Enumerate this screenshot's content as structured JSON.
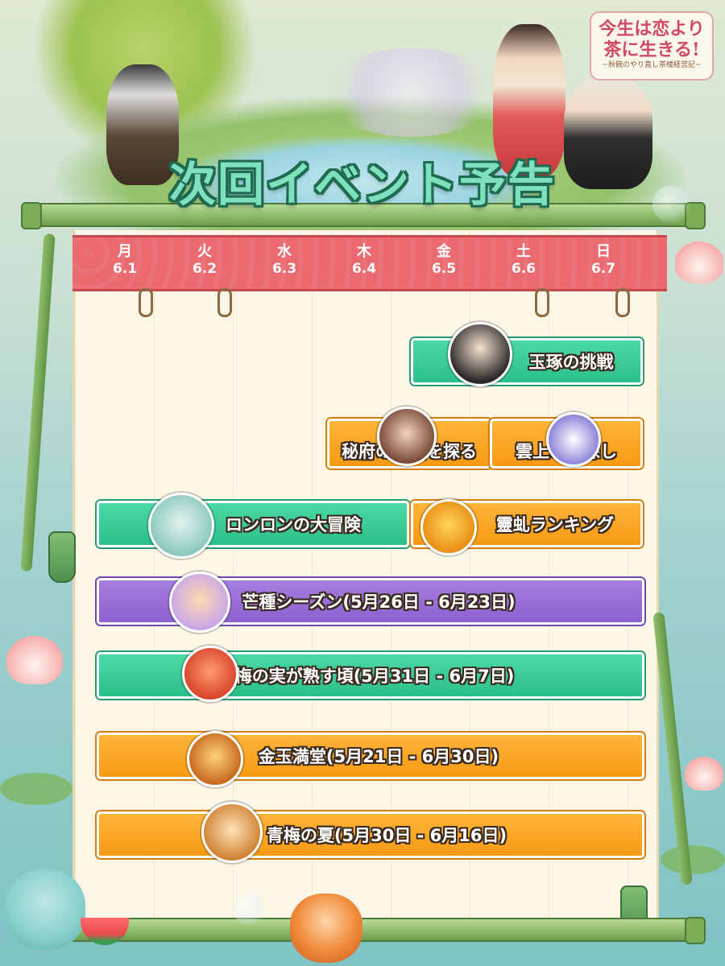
{
  "title": "次回イベント予告",
  "logo": {
    "line1": "今生は恋より",
    "line2": "茶に生きる!",
    "subtitle": "~秋碗のやり直し茶楼経営記~"
  },
  "colors": {
    "day_band": "#ea6a70",
    "teal": "#2cbf8a",
    "orange": "#f79a14",
    "purple": "#8b62cf",
    "paper": "#fbf6e6"
  },
  "days": [
    {
      "weekday": "月",
      "date": "6.1"
    },
    {
      "weekday": "火",
      "date": "6.2"
    },
    {
      "weekday": "水",
      "date": "6.3"
    },
    {
      "weekday": "木",
      "date": "6.4"
    },
    {
      "weekday": "金",
      "date": "6.5"
    },
    {
      "weekday": "土",
      "date": "6.6"
    },
    {
      "weekday": "日",
      "date": "6.7"
    }
  ],
  "events": [
    {
      "label": "玉琢の挑戦",
      "color": "teal",
      "icon": "girl-portrait-icon"
    },
    {
      "label": "秘府の奥義を探る",
      "color": "orange",
      "icon": "lady-room-icon"
    },
    {
      "label": "雲上の宝探し",
      "color": "orange",
      "icon": "cloud-bird-icon"
    },
    {
      "label": "ロンロンの大冒険",
      "color": "teal",
      "icon": "dragon-cat-icon"
    },
    {
      "label": "靈虬ランキング",
      "color": "orange",
      "icon": "golden-dragon-icon"
    },
    {
      "label": "芒種シーズン(5月26日 - 6月23日)",
      "color": "purple",
      "icon": "farmer-cat-icon"
    },
    {
      "label": "梅の実が熟す頃(5月31日 - 6月7日)",
      "color": "teal",
      "icon": "red-fox-icon"
    },
    {
      "label": "金玉満堂(5月21日 - 6月30日)",
      "color": "orange",
      "icon": "treasure-pot-icon"
    },
    {
      "label": "青梅の夏(5月30日 - 6月16日)",
      "color": "orange",
      "icon": "shiba-warrior-icon"
    }
  ]
}
